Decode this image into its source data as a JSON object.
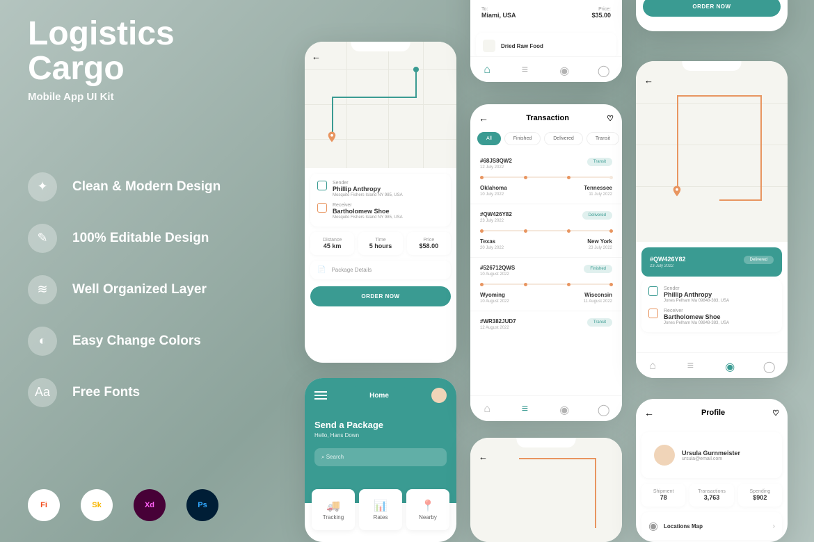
{
  "hero": {
    "title1": "Logistics",
    "title2": "Cargo",
    "subtitle": "Mobile App UI Kit"
  },
  "features": [
    "Clean & Modern Design",
    "100% Editable Design",
    "Well Organized Layer",
    "Easy Change Colors",
    "Free Fonts"
  ],
  "tools": [
    "Fi",
    "Sk",
    "Xd",
    "Ps"
  ],
  "screen1": {
    "sender_lbl": "Sender",
    "sender": "Phillip Anthropy",
    "sender_addr": "Mosquito Fishers Island NY 985, USA",
    "receiver_lbl": "Receiver",
    "receiver": "Bartholomew Shoe",
    "receiver_addr": "Mosquito Fishers Island NY 985, USA",
    "dist_lbl": "Distance",
    "dist": "45 km",
    "time_lbl": "Time",
    "time": "5 hours",
    "price_lbl": "Price",
    "price": "$58.00",
    "pkg": "Package Details",
    "btn": "ORDER NOW"
  },
  "screen2": {
    "title": "Home",
    "heading": "Send a Package",
    "greet": "Hello, Hans Down",
    "search": "Search",
    "q1": "Tracking",
    "q2": "Rates",
    "q3": "Nearby"
  },
  "screen3": {
    "to_lbl": "To:",
    "to": "Miami, USA",
    "price_lbl": "Price:",
    "price": "$35.00",
    "item": "Dried Raw Food"
  },
  "screen4": {
    "title": "Transaction",
    "chips": [
      "All",
      "Finished",
      "Delivered",
      "Transit"
    ],
    "tx": [
      {
        "id": "#68JS8QW2",
        "date": "12 July 2022",
        "status": "Transit",
        "from": "Oklahoma",
        "fdate": "10 July 2022",
        "to": "Tennessee",
        "tdate": "11 July 2022"
      },
      {
        "id": "#QW426Y82",
        "date": "23 July 2022",
        "status": "Delivered",
        "from": "Texas",
        "fdate": "20 July 2022",
        "to": "New York",
        "tdate": "23 July 2022"
      },
      {
        "id": "#526712QWS",
        "date": "10 August 2022",
        "status": "Finished",
        "from": "Wyoming",
        "fdate": "10 August 2022",
        "to": "Wisconsin",
        "tdate": "11 August 2022"
      },
      {
        "id": "#WR382JUD7",
        "date": "12 August 2022",
        "status": "Transit",
        "from": "",
        "fdate": "",
        "to": "",
        "tdate": ""
      }
    ]
  },
  "screen6": {
    "btn": "ORDER NOW"
  },
  "screen7": {
    "id": "#QW426Y82",
    "date": "23 July 2022",
    "status": "Delivered",
    "sender_lbl": "Sender",
    "sender": "Phillip Anthropy",
    "sender_addr": "Jones Pelham Ma 09848-383, USA",
    "receiver_lbl": "Receiver",
    "receiver": "Bartholomew Shoe",
    "receiver_addr": "Jones Pelham Ma 09848-383, USA"
  },
  "screen8": {
    "title": "Profile",
    "name": "Ursula Gurnmeister",
    "email": "ursula@email.com",
    "s1_lbl": "Shipment",
    "s1": "78",
    "s2_lbl": "Transactions",
    "s2": "3,763",
    "s3_lbl": "Spending",
    "s3": "$902",
    "loc": "Locations Map"
  }
}
